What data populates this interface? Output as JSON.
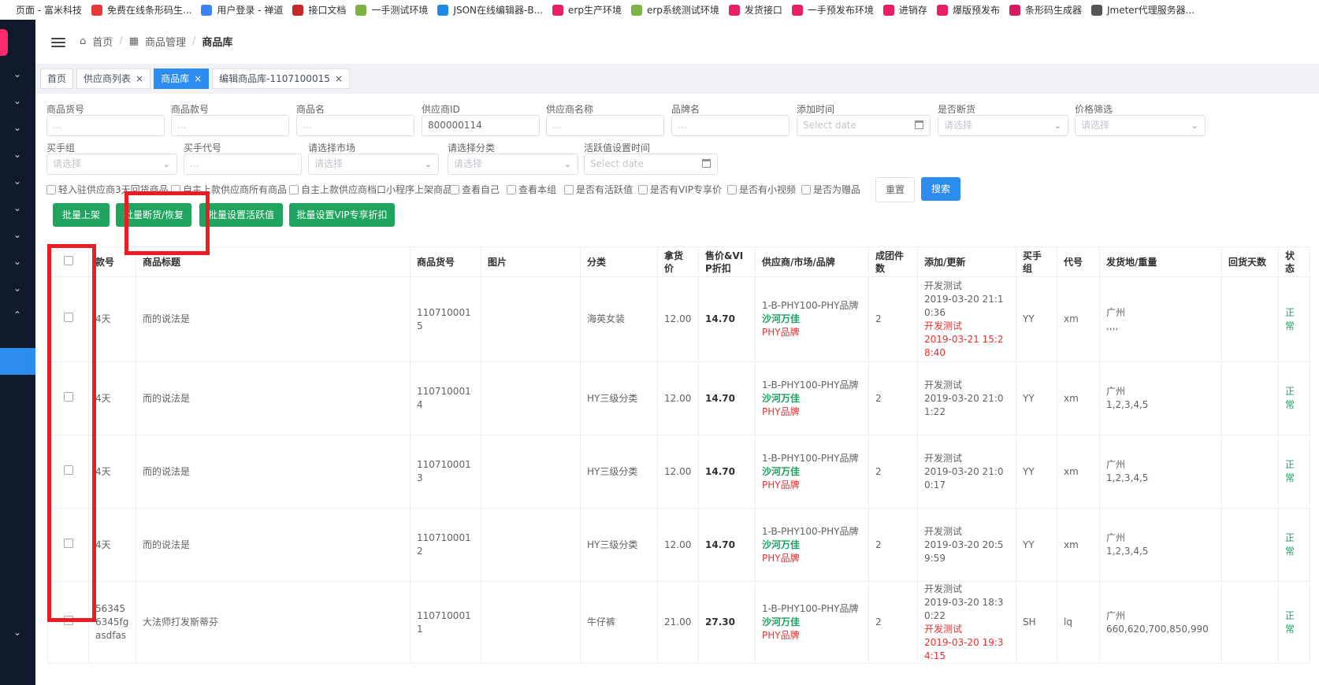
{
  "bookmarks": [
    {
      "label": "页面 - 富米科技",
      "color": "#ffffff"
    },
    {
      "label": "免费在线条形码生...",
      "color": "#e53935"
    },
    {
      "label": "用户登录 - 禅道",
      "color": "#3b82f6"
    },
    {
      "label": "接口文档",
      "color": "#c62828"
    },
    {
      "label": "一手测试环境",
      "color": "#7cb342"
    },
    {
      "label": "JSON在线编辑器-B...",
      "color": "#1e88e5"
    },
    {
      "label": "erp生产环境",
      "color": "#e91e63"
    },
    {
      "label": "erp系统测试环境",
      "color": "#7cb342"
    },
    {
      "label": "发货接口",
      "color": "#e91e63"
    },
    {
      "label": "一手预发布环境",
      "color": "#e91e63"
    },
    {
      "label": "进销存",
      "color": "#e91e63"
    },
    {
      "label": "爆版预发布",
      "color": "#e91e63"
    },
    {
      "label": "条形码生成器",
      "color": "#d81b60"
    },
    {
      "label": "Jmeter代理服务器...",
      "color": "#555555"
    }
  ],
  "breadcrumb": {
    "home": "首页",
    "module": "商品管理",
    "current": "商品库"
  },
  "tabs": [
    {
      "label": "首页",
      "closable": false,
      "active": false
    },
    {
      "label": "供应商列表",
      "closable": true,
      "active": false
    },
    {
      "label": "商品库",
      "closable": true,
      "active": true
    },
    {
      "label": "编辑商品库-1107100015",
      "closable": true,
      "active": false
    }
  ],
  "filters": {
    "goods_no": {
      "label": "商品货号",
      "placeholder": "..."
    },
    "style_no": {
      "label": "商品款号",
      "placeholder": "..."
    },
    "goods_name": {
      "label": "商品名",
      "placeholder": "..."
    },
    "supplier_id": {
      "label": "供应商ID",
      "value": "800000114"
    },
    "supplier_name": {
      "label": "供应商名称",
      "placeholder": "..."
    },
    "brand": {
      "label": "品牌名",
      "placeholder": "..."
    },
    "add_time": {
      "label": "添加时间",
      "placeholder": "Select date"
    },
    "out_of_stock": {
      "label": "是否断货",
      "placeholder": "请选择"
    },
    "price_filter": {
      "label": "价格筛选",
      "placeholder": "请选择"
    },
    "buyer_group": {
      "label": "买手组",
      "placeholder": "请选择"
    },
    "buyer_code": {
      "label": "买手代号",
      "placeholder": "..."
    },
    "market": {
      "label": "请选择市场",
      "placeholder": "请选择"
    },
    "category": {
      "label": "请选择分类",
      "placeholder": "请选择"
    },
    "active_time": {
      "label": "活跃值设置时间",
      "placeholder": "Select date"
    }
  },
  "checkboxes": [
    "轻入驻供应商3天回货商品",
    "自主上款供应商所有商品",
    "自主上款供应商档口小程序上架商品",
    "查看自己",
    "查看本组",
    "是否有活跃值",
    "是否有VIP专享价",
    "是否有小视频",
    "是否为赠品"
  ],
  "buttons": {
    "reset": "重置",
    "search": "搜索",
    "batch_shelf": "批量上架",
    "batch_stock": "批量断货/恢复",
    "batch_active": "批量设置活跃值",
    "batch_vip": "批量设置VIP专享折扣"
  },
  "table": {
    "headers": [
      "",
      "款号",
      "商品标题",
      "商品货号",
      "图片",
      "分类",
      "拿货价",
      "售价&VIP折扣",
      "供应商/市场/品牌",
      "成团件数",
      "添加/更新",
      "买手组",
      "代号",
      "发货地/重量",
      "回货天数",
      "状态"
    ],
    "rows": [
      {
        "style": "4天",
        "title": "而的说法是",
        "goods_no": "1107100015",
        "category": "海英女装",
        "cost": "12.00",
        "price": "14.70",
        "supplier": "1-B-PHY100-PHY品牌",
        "market": "沙河万佳",
        "brand": "PHY品牌",
        "min_qty": "2",
        "add_user": "开发测试",
        "add_time": "2019-03-20 21:10:36",
        "upd_user": "开发测试",
        "upd_time": "2019-03-21 15:28:40",
        "buyer_group": "YY",
        "code": "xm",
        "ship_from": "广州",
        "weight": ",,,,",
        "return_days": "",
        "status": "正常"
      },
      {
        "style": "4天",
        "title": "而的说法是",
        "goods_no": "1107100014",
        "category": "HY三级分类",
        "cost": "12.00",
        "price": "14.70",
        "supplier": "1-B-PHY100-PHY品牌",
        "market": "沙河万佳",
        "brand": "PHY品牌",
        "min_qty": "2",
        "add_user": "开发测试",
        "add_time": "2019-03-20 21:01:22",
        "upd_user": "",
        "upd_time": "",
        "buyer_group": "YY",
        "code": "xm",
        "ship_from": "广州",
        "weight": "1,2,3,4,5",
        "return_days": "",
        "status": "正常"
      },
      {
        "style": "4天",
        "title": "而的说法是",
        "goods_no": "1107100013",
        "category": "HY三级分类",
        "cost": "12.00",
        "price": "14.70",
        "supplier": "1-B-PHY100-PHY品牌",
        "market": "沙河万佳",
        "brand": "PHY品牌",
        "min_qty": "2",
        "add_user": "开发测试",
        "add_time": "2019-03-20 21:00:17",
        "upd_user": "",
        "upd_time": "",
        "buyer_group": "YY",
        "code": "xm",
        "ship_from": "广州",
        "weight": "1,2,3,4,5",
        "return_days": "",
        "status": "正常"
      },
      {
        "style": "4天",
        "title": "而的说法是",
        "goods_no": "1107100012",
        "category": "HY三级分类",
        "cost": "12.00",
        "price": "14.70",
        "supplier": "1-B-PHY100-PHY品牌",
        "market": "沙河万佳",
        "brand": "PHY品牌",
        "min_qty": "2",
        "add_user": "开发测试",
        "add_time": "2019-03-20 20:59:59",
        "upd_user": "",
        "upd_time": "",
        "buyer_group": "YY",
        "code": "xm",
        "ship_from": "广州",
        "weight": "1,2,3,4,5",
        "return_days": "",
        "status": "正常"
      },
      {
        "style": "563456345fgasdfas",
        "title": "大法师打发斯蒂芬",
        "goods_no": "1107100011",
        "category": "牛仔裤",
        "cost": "21.00",
        "price": "27.30",
        "supplier": "1-B-PHY100-PHY品牌",
        "market": "沙河万佳",
        "brand": "PHY品牌",
        "min_qty": "2",
        "add_user": "开发测试",
        "add_time": "2019-03-20 18:30:22",
        "upd_user": "开发测试",
        "upd_time": "2019-03-20 19:34:15",
        "buyer_group": "SH",
        "code": "lq",
        "ship_from": "广州",
        "weight": "660,620,700,850,990",
        "return_days": "",
        "status": "正常"
      }
    ]
  },
  "colors": {
    "primary": "#2d8cf0",
    "success": "#1fa55f",
    "highlight": "#ec1c24",
    "sidebar": "#0f1b2d"
  }
}
